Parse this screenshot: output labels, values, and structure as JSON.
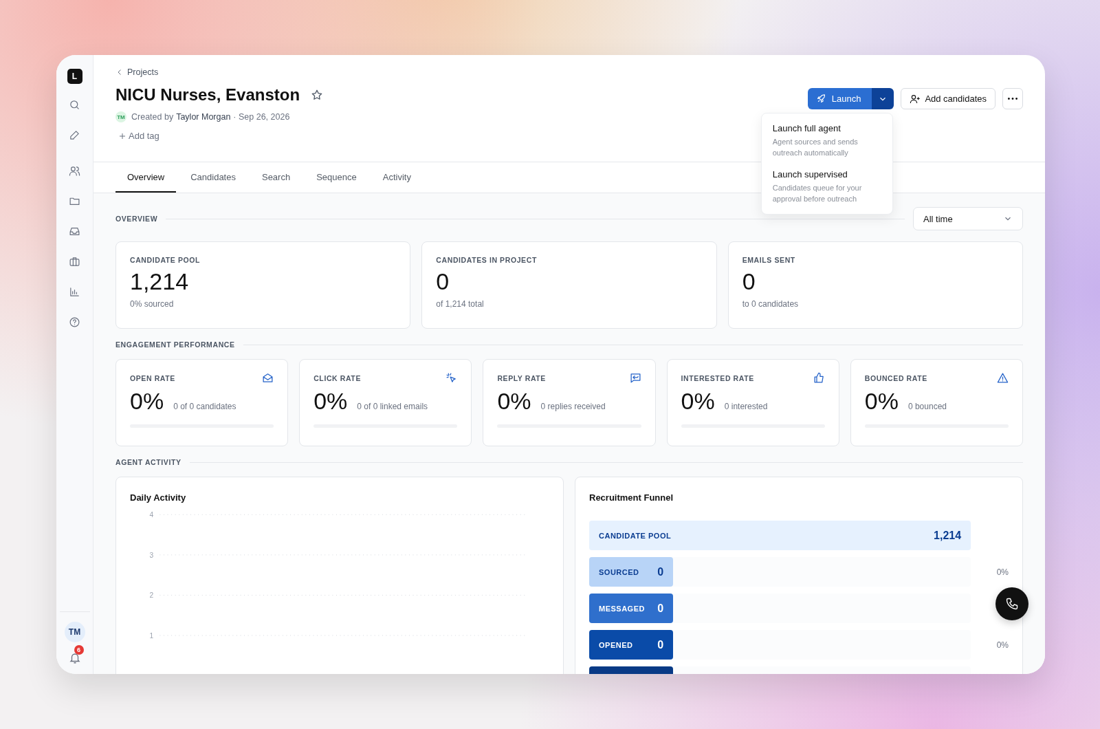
{
  "sidebar": {
    "logo": "L",
    "items": [
      {
        "selected": false
      },
      {
        "selected": false
      },
      {
        "selected": false
      },
      {
        "selected": false
      },
      {
        "selected": false
      },
      {
        "selected": false
      },
      {
        "selected": false
      },
      {
        "selected": false
      }
    ],
    "avatar": "TM",
    "notifications": "6"
  },
  "header": {
    "breadcrumb": "Projects",
    "title": "NICU Nurses, Evanston",
    "creator_initials": "TM",
    "created_by": "Created by",
    "creator": "Taylor Morgan",
    "date": "· Sep 26, 2026",
    "add_tag": "Add tag"
  },
  "actions": {
    "launch": "Launch",
    "add_candidates": "Add candidates"
  },
  "launch_menu": [
    {
      "title": "Launch full agent",
      "description": "Agent sources and sends outreach automatically"
    },
    {
      "title": "Launch supervised",
      "description": "Candidates queue for your approval before outreach"
    }
  ],
  "tabs": [
    {
      "label": "Overview",
      "selected": true
    },
    {
      "label": "Candidates",
      "selected": false
    },
    {
      "label": "Search",
      "selected": false
    },
    {
      "label": "Sequence",
      "selected": false
    },
    {
      "label": "Activity",
      "selected": false
    }
  ],
  "overview": {
    "label": "OVERVIEW",
    "period": "All time",
    "stats": [
      {
        "label": "CANDIDATE POOL",
        "value": "1,214",
        "note": "0% sourced"
      },
      {
        "label": "CANDIDATES IN PROJECT",
        "value": "0",
        "note": "of 1,214 total"
      },
      {
        "label": "EMAILS SENT",
        "value": "0",
        "note": "to 0 candidates"
      }
    ]
  },
  "engagement": {
    "label": "ENGAGEMENT PERFORMANCE",
    "rates": [
      {
        "label": "OPEN RATE",
        "value": "0%",
        "note": "0 of 0 candidates",
        "level": 0
      },
      {
        "label": "CLICK RATE",
        "value": "0%",
        "note": "0 of 0 linked emails",
        "level": 0
      },
      {
        "label": "REPLY RATE",
        "value": "0%",
        "note": "0 replies received",
        "level": 0
      },
      {
        "label": "INTERESTED RATE",
        "value": "0%",
        "note": "0 interested",
        "level": 0
      },
      {
        "label": "BOUNCED RATE",
        "value": "0%",
        "note": "0 bounced",
        "level": 0
      }
    ]
  },
  "agent_activity": {
    "label": "AGENT ACTIVITY",
    "daily": {
      "title": "Daily Activity",
      "axis_labels": [
        "4",
        "3",
        "2",
        "1"
      ]
    },
    "funnel": {
      "title": "Recruitment Funnel",
      "stages": [
        {
          "label": "CANDIDATE POOL",
          "value": "1,214",
          "level": 1,
          "color": "#e6f1fe"
        },
        {
          "label": "SOURCED",
          "value": "0",
          "pct": "0%",
          "level": 0.22,
          "color": "#b8d4f7"
        },
        {
          "label": "MESSAGED",
          "value": "0",
          "level": 0.22,
          "color": "#2f6fcc"
        },
        {
          "label": "OPENED",
          "value": "0",
          "pct": "0%",
          "level": 0.22,
          "color": "#0a4ba8"
        },
        {
          "level": 0.22,
          "color": "#083a86"
        }
      ]
    }
  }
}
